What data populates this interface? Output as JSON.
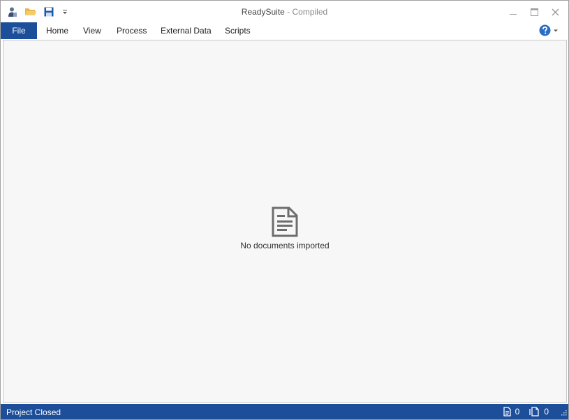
{
  "window": {
    "title": "ReadySuite",
    "title_separator": " - ",
    "subtitle": "Compiled"
  },
  "quick_access": [
    {
      "name": "app-user-icon"
    },
    {
      "name": "open-folder-icon"
    },
    {
      "name": "save-icon"
    },
    {
      "name": "customize-dropdown-icon"
    }
  ],
  "window_controls": [
    "minimize-icon",
    "maximize-icon",
    "close-icon"
  ],
  "ribbon": {
    "tabs": [
      {
        "label": "File"
      },
      {
        "label": "Home"
      },
      {
        "label": "View"
      },
      {
        "label": "Process"
      },
      {
        "label": "External Data"
      },
      {
        "label": "Scripts"
      }
    ],
    "help_icon": "help-icon"
  },
  "main": {
    "empty_icon": "document-icon",
    "empty_message": "No documents imported"
  },
  "status": {
    "text": "Project Closed",
    "documents_count": "0",
    "pages_count": "0"
  },
  "colors": {
    "accent": "#1c4e9a",
    "content_bg": "#f7f7f7",
    "folder": "#e8b94a",
    "save": "#1c5aa8",
    "help": "#2b6cc4"
  }
}
